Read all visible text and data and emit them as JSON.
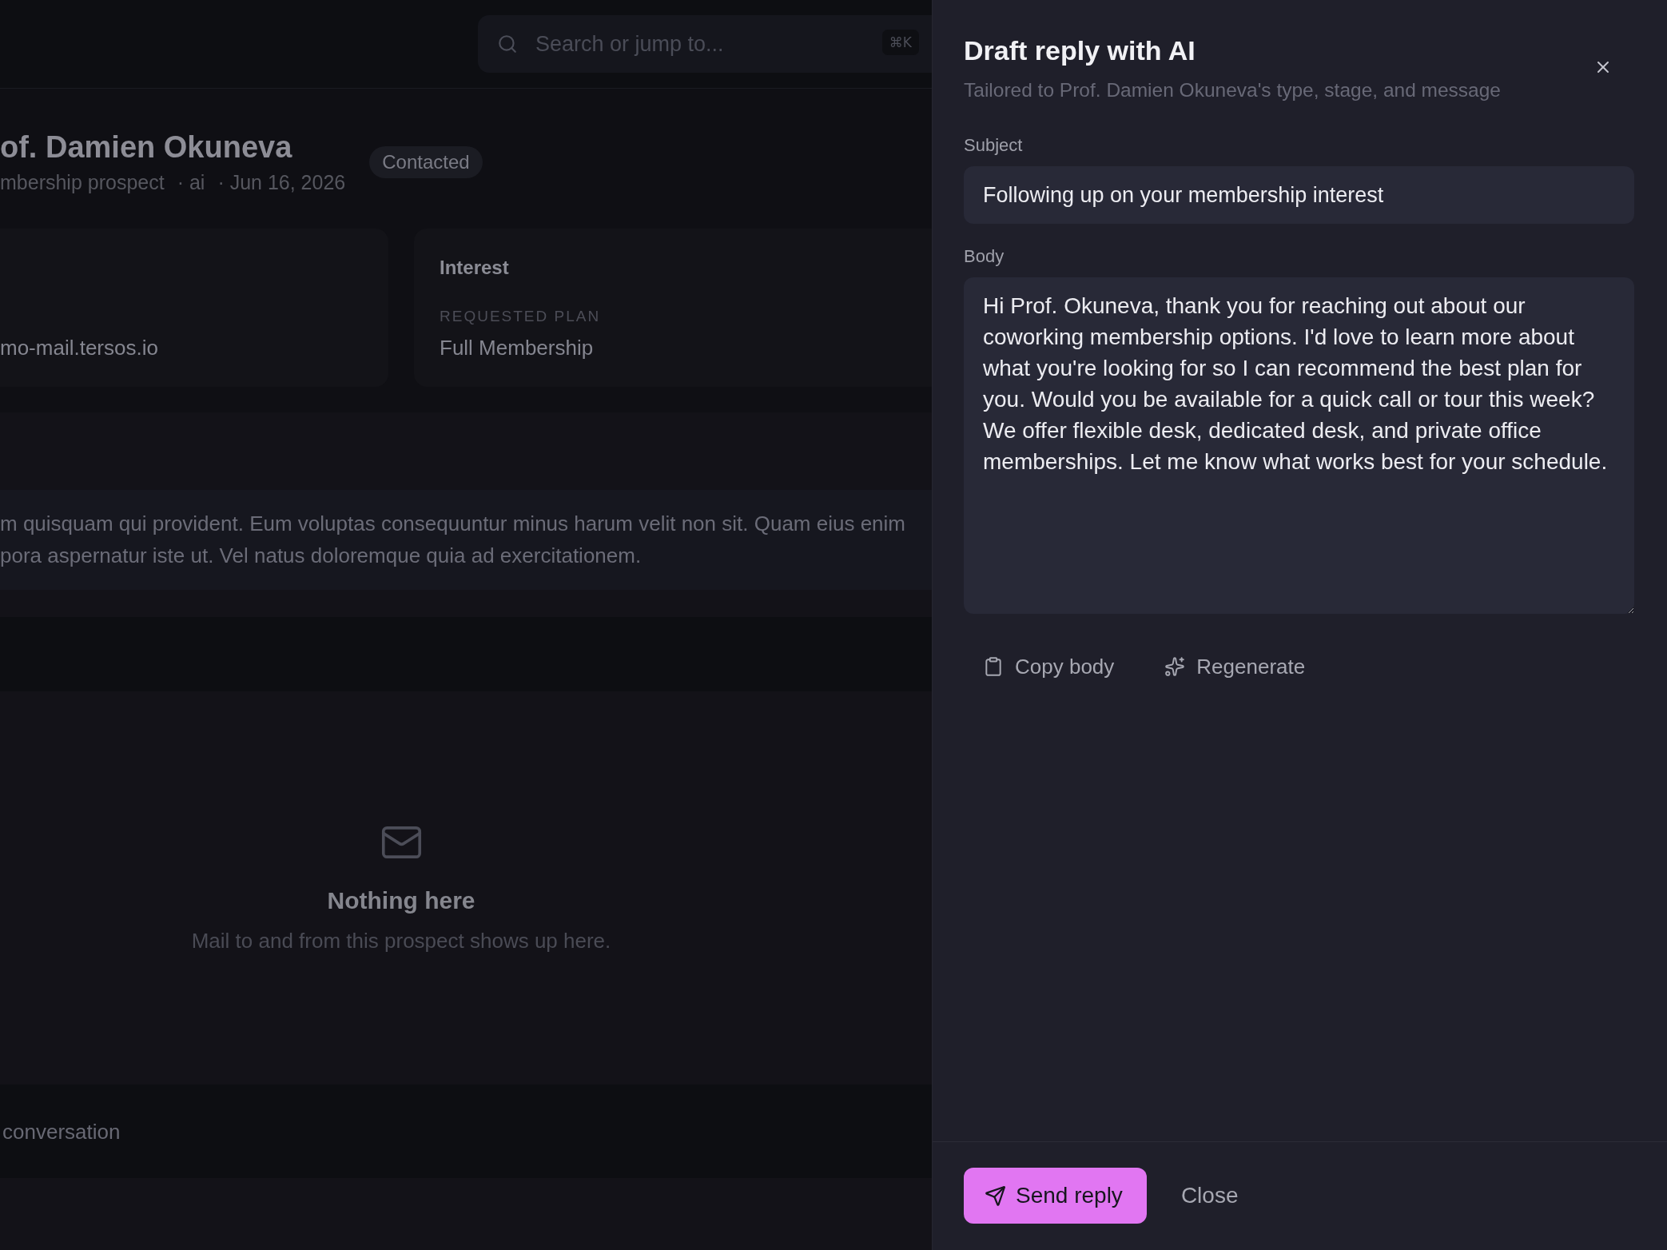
{
  "topbar": {
    "search": {
      "placeholder": "Search or jump to...",
      "shortcut": "⌘K"
    }
  },
  "prospect": {
    "name": "of. Damien Okuneva",
    "meta": [
      "mbership prospect",
      "· ai",
      "· Jun 16, 2026"
    ],
    "status": "Contacted"
  },
  "cards": [
    {
      "value": "mo-mail.tersos.io"
    },
    {
      "title": "Interest",
      "label": "REQUESTED PLAN",
      "value": "Full Membership"
    }
  ],
  "message": {
    "text": "m quisquam qui provident. Eum voluptas consequuntur minus harum velit non sit. Quam eius enim\npora aspernatur iste ut. Vel natus doloremque quia ad exercitationem."
  },
  "mail": {
    "title": "Nothing here",
    "text": "Mail to and from this prospect shows up here."
  },
  "reply_bar": {
    "text": "conversation"
  },
  "drawer": {
    "title": "Draft reply with AI",
    "subtitle": "Tailored to Prof. Damien Okuneva's type, stage, and message",
    "fields": [
      {
        "kind": "input",
        "label": "Subject",
        "value": "Following up on your membership interest"
      },
      {
        "kind": "textarea",
        "label": "Body",
        "value": "Hi Prof. Okuneva, thank you for reaching out about our coworking membership options. I'd love to learn more about what you're looking for so I can recommend the best plan for you. Would you be available for a quick call or tour this week? We offer flexible desk, dedicated desk, and private office memberships. Let me know what works best for your schedule."
      }
    ],
    "actions": [
      {
        "kind": "copy",
        "label": "Copy body"
      },
      {
        "kind": "regenerate",
        "label": "Regenerate"
      }
    ],
    "footer": {
      "primary": "Send reply",
      "secondary": "Close"
    }
  }
}
